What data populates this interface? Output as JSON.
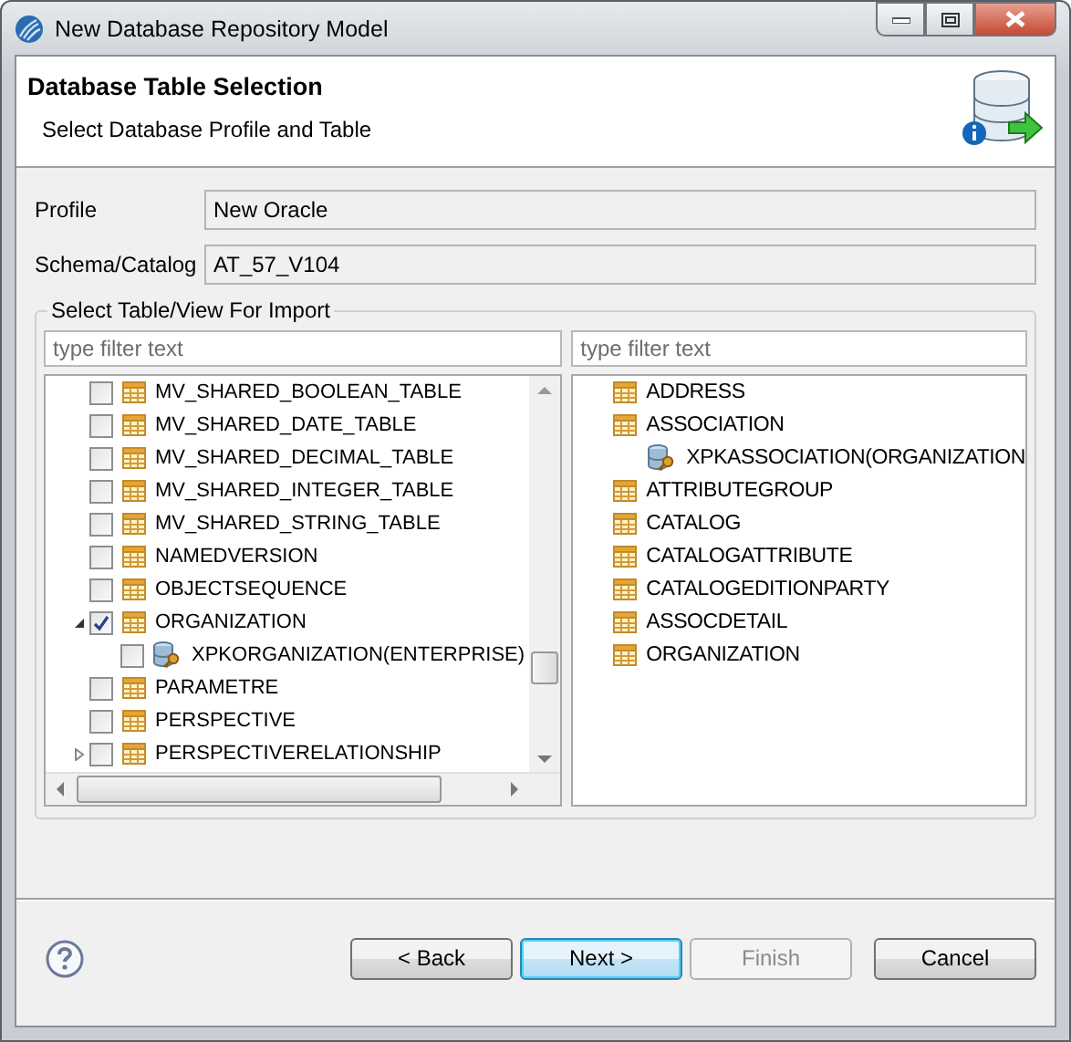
{
  "window": {
    "title": "New Database Repository Model"
  },
  "header": {
    "title": "Database Table Selection",
    "subtitle": "Select Database Profile and Table"
  },
  "fields": [
    {
      "label": "Profile",
      "value": "New Oracle"
    },
    {
      "label": "Schema/Catalog",
      "value": "AT_57_V104"
    }
  ],
  "import_group": {
    "legend": "Select Table/View For Import",
    "available": {
      "filter": {
        "placeholder": "type filter text"
      },
      "items": [
        {
          "label": "MV_SHARED_BOOLEAN_TABLE",
          "kind": "table",
          "checked": false
        },
        {
          "label": "MV_SHARED_DATE_TABLE",
          "kind": "table",
          "checked": false
        },
        {
          "label": "MV_SHARED_DECIMAL_TABLE",
          "kind": "table",
          "checked": false
        },
        {
          "label": "MV_SHARED_INTEGER_TABLE",
          "kind": "table",
          "checked": false
        },
        {
          "label": "MV_SHARED_STRING_TABLE",
          "kind": "table",
          "checked": false
        },
        {
          "label": "NAMEDVERSION",
          "kind": "table",
          "checked": false
        },
        {
          "label": "OBJECTSEQUENCE",
          "kind": "table",
          "checked": false
        },
        {
          "label": "ORGANIZATION",
          "kind": "table",
          "checked": true,
          "expanded": true,
          "children": [
            {
              "label": "XPKORGANIZATION(ENTERPRISE)",
              "kind": "key",
              "checked": false
            }
          ]
        },
        {
          "label": "PARAMETRE",
          "kind": "table",
          "checked": false
        },
        {
          "label": "PERSPECTIVE",
          "kind": "table",
          "checked": false
        },
        {
          "label": "PERSPECTIVERELATIONSHIP",
          "kind": "table",
          "checked": false,
          "expanded": false
        }
      ]
    },
    "selected": {
      "filter": {
        "placeholder": "type filter text"
      },
      "items": [
        {
          "label": "ADDRESS",
          "kind": "table"
        },
        {
          "label": "ASSOCIATION",
          "kind": "table",
          "children": [
            {
              "label": "XPKASSOCIATION(ORGANIZATION",
              "kind": "key"
            }
          ]
        },
        {
          "label": "ATTRIBUTEGROUP",
          "kind": "table"
        },
        {
          "label": "CATALOG",
          "kind": "table"
        },
        {
          "label": "CATALOGATTRIBUTE",
          "kind": "table"
        },
        {
          "label": "CATALOGEDITIONPARTY",
          "kind": "table"
        },
        {
          "label": "ASSOCDETAIL",
          "kind": "table"
        },
        {
          "label": "ORGANIZATION",
          "kind": "table"
        }
      ]
    }
  },
  "buttons": [
    {
      "label": "< Back",
      "default": false,
      "disabled": false
    },
    {
      "label": "Next >",
      "default": true,
      "disabled": false
    },
    {
      "label": "Finish",
      "default": false,
      "disabled": true
    },
    {
      "label": "Cancel",
      "default": false,
      "disabled": false
    }
  ]
}
